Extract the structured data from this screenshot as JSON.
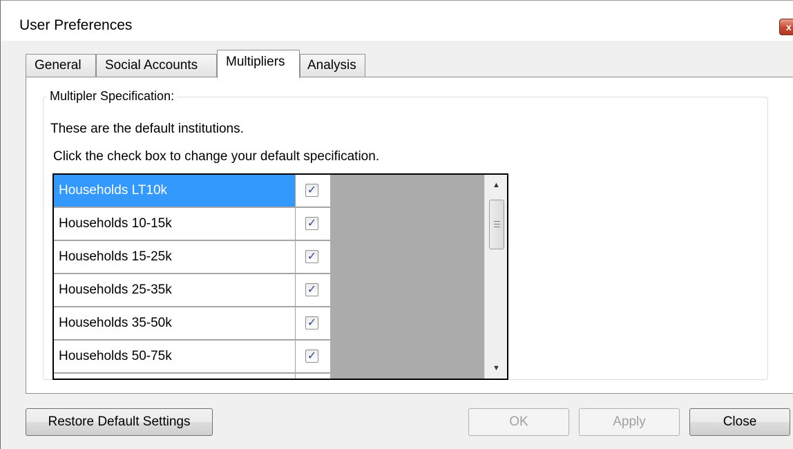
{
  "window": {
    "title": "User Preferences",
    "close_glyph": "x"
  },
  "tabs": [
    {
      "label": "General",
      "active": false
    },
    {
      "label": "Social Accounts",
      "active": false
    },
    {
      "label": "Multipliers",
      "active": true
    },
    {
      "label": "Analysis",
      "active": false
    }
  ],
  "group": {
    "legend": "Multipler Specification:",
    "line1": "These are the default institutions.",
    "line2": "Click the check box to change your default specification."
  },
  "list": {
    "rows": [
      {
        "name": "Households LT10k",
        "checked": true,
        "selected": true
      },
      {
        "name": "Households 10-15k",
        "checked": true,
        "selected": false
      },
      {
        "name": "Households 15-25k",
        "checked": true,
        "selected": false
      },
      {
        "name": "Households 25-35k",
        "checked": true,
        "selected": false
      },
      {
        "name": "Households 35-50k",
        "checked": true,
        "selected": false
      },
      {
        "name": "Households 50-75k",
        "checked": true,
        "selected": false
      }
    ],
    "check_glyph": "✓",
    "scroll_up_glyph": "▲",
    "scroll_down_glyph": "▼"
  },
  "buttons": {
    "restore": "Restore Default Settings",
    "ok": "OK",
    "apply": "Apply",
    "close": "Close"
  },
  "colors": {
    "selection": "#3399ff",
    "list_empty_area": "#ababab"
  }
}
